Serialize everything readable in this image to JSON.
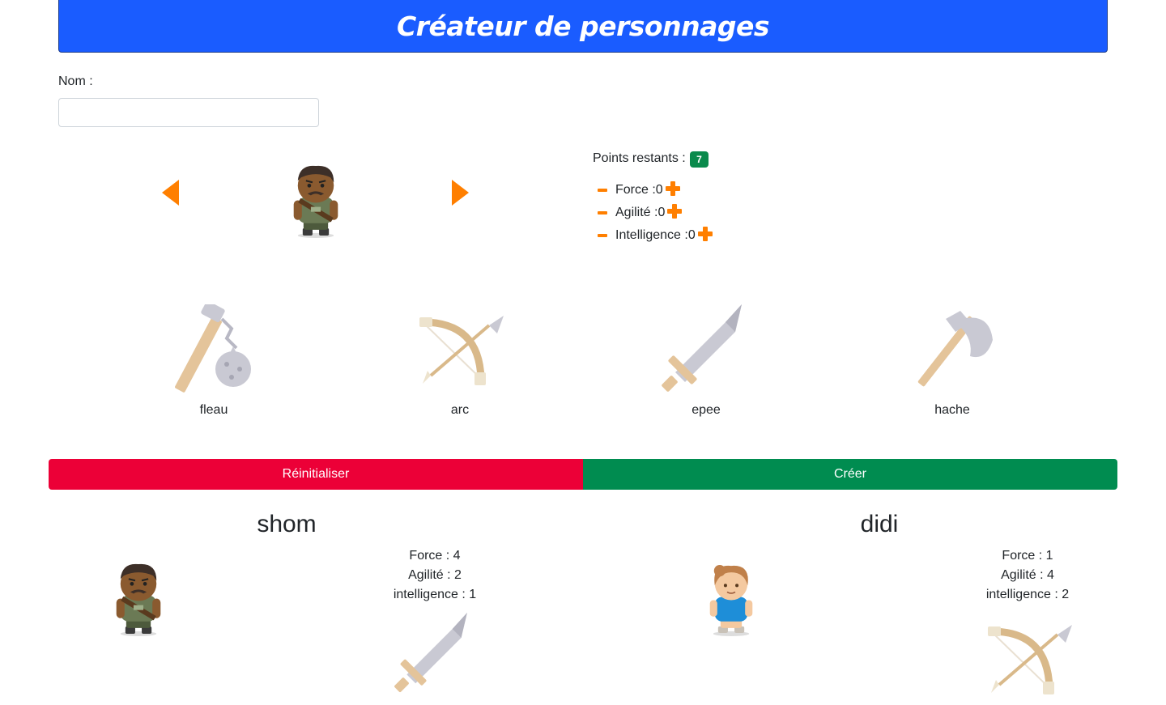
{
  "header": {
    "title": "Créateur de personnages"
  },
  "form": {
    "name_label": "Nom :",
    "name_value": "",
    "name_placeholder": ""
  },
  "points": {
    "label": "Points restants :",
    "remaining": "7"
  },
  "stats": [
    {
      "label": "Force :",
      "value": "0"
    },
    {
      "label": "Agilité :",
      "value": "0"
    },
    {
      "label": "Intelligence :",
      "value": "0"
    }
  ],
  "weapons": [
    {
      "label": "fleau",
      "icon": "flail-icon"
    },
    {
      "label": "arc",
      "icon": "bow-icon"
    },
    {
      "label": "epee",
      "icon": "sword-icon"
    },
    {
      "label": "hache",
      "icon": "axe-icon"
    }
  ],
  "actions": {
    "reset_label": "Réinitialiser",
    "create_label": "Créer"
  },
  "characters": [
    {
      "name": "shom",
      "stats": [
        "Force : 4",
        "Agilité : 2",
        "intelligence : 1"
      ],
      "weapon": "sword-icon",
      "avatar": "warrior-icon"
    },
    {
      "name": "didi",
      "stats": [
        "Force : 1",
        "Agilité : 4",
        "intelligence : 2"
      ],
      "weapon": "bow-icon",
      "avatar": "girl-icon"
    }
  ],
  "colors": {
    "header": "#1a5cff",
    "accent": "#ff7f00",
    "reset": "#ec0037",
    "create": "#008c50",
    "badge": "#0a8a4c"
  }
}
